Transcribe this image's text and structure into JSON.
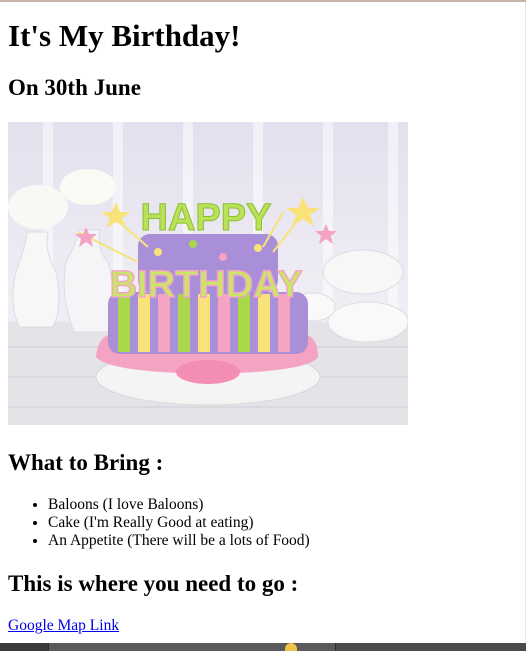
{
  "page": {
    "title": "It's My Birthday!",
    "date_heading": "On 30th June",
    "bring_heading": "What to Bring :",
    "bring_items": [
      "Baloons (I love Baloons)",
      "Cake (I'm Really Good at eating)",
      "An Appetite (There will be a lots of Food)"
    ],
    "go_heading": "This is where you need to go :",
    "map_link": "Google Map Link"
  },
  "image": {
    "cake_topper_word_1": "HAPPY",
    "cake_topper_word_2": "BIRTHDAY"
  },
  "colors": {
    "link": "#0000ee",
    "cake_purple": "#a98ed8",
    "cake_pink": "#f4a3c3",
    "cake_lime": "#a9d84a"
  }
}
